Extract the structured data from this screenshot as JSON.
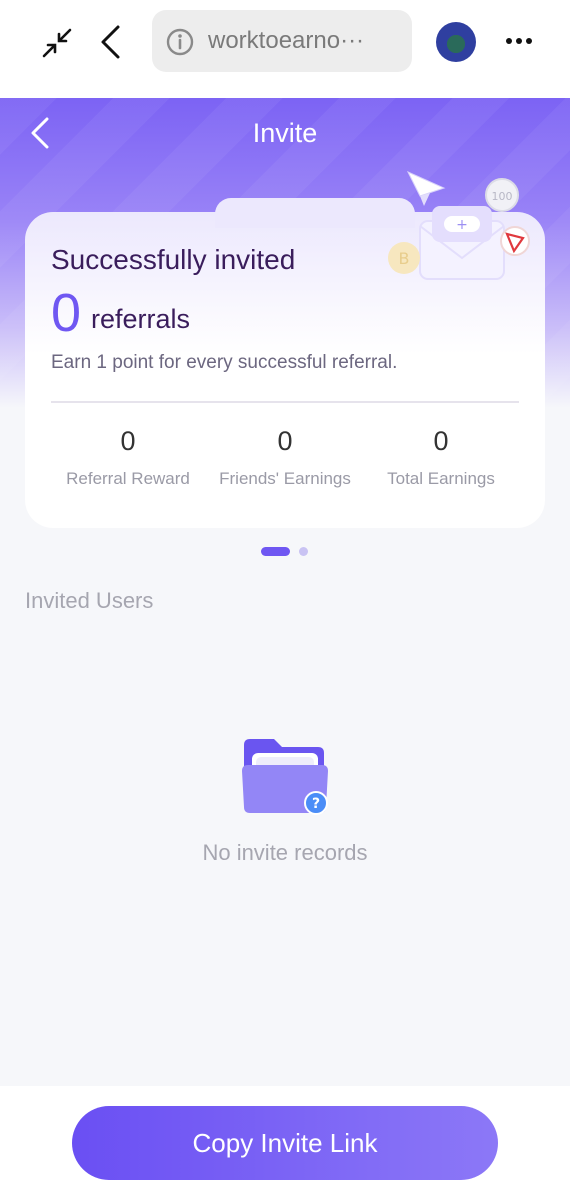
{
  "browser": {
    "url_text": "worktoearno···"
  },
  "header": {
    "title": "Invite"
  },
  "summary": {
    "title": "Successfully invited",
    "referral_count": "0",
    "referral_label": "referrals",
    "description": "Earn 1 point for every successful referral.",
    "stats": [
      {
        "value": "0",
        "label": "Referral Reward"
      },
      {
        "value": "0",
        "label": "Friends' Earnings"
      },
      {
        "value": "0",
        "label": "Total Earnings"
      }
    ]
  },
  "pager": {
    "count": 2,
    "active": 0
  },
  "invited": {
    "section_title": "Invited Users",
    "empty_text": "No invite records"
  },
  "footer": {
    "button_label": "Copy Invite Link"
  },
  "colors": {
    "accent": "#6f57f2",
    "title_text": "#3a1d5c",
    "muted_text": "#a6a6b0"
  }
}
